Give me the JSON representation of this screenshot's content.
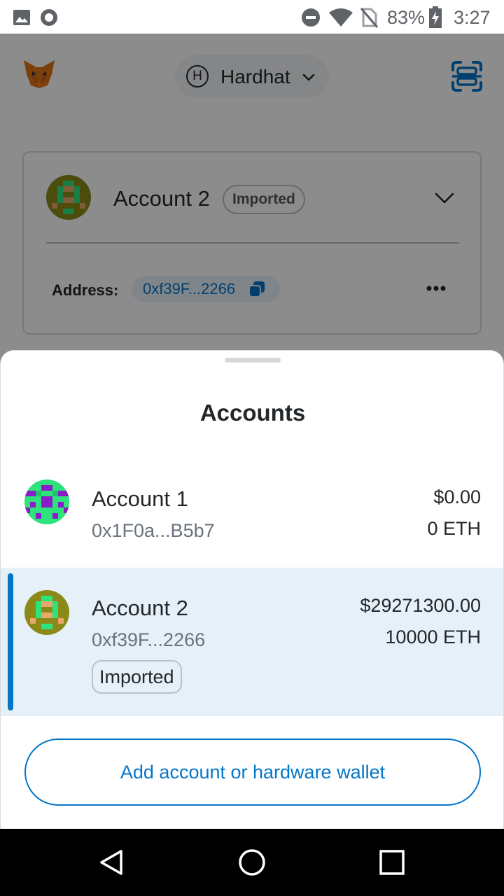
{
  "status_bar": {
    "battery": "83%",
    "time": "3:27",
    "icons": [
      "image-icon",
      "record-icon",
      "do-not-disturb-icon",
      "wifi-icon",
      "no-sim-icon",
      "battery-charging-icon"
    ]
  },
  "header": {
    "logo": "metamask-fox-logo",
    "network": {
      "badge": "H",
      "name": "Hardhat"
    },
    "scan_icon": "qr-scan-icon"
  },
  "account_card": {
    "name": "Account 2",
    "tag": "Imported",
    "address_label": "Address:",
    "address": "0xf39F...2266",
    "more_icon": "more-horizontal-icon"
  },
  "sheet": {
    "title": "Accounts",
    "accounts": [
      {
        "name": "Account 1",
        "address": "0x1F0a...B5b7",
        "fiat": "$0.00",
        "eth": "0 ETH",
        "selected": false
      },
      {
        "name": "Account 2",
        "address": "0xf39F...2266",
        "fiat": "$29271300.00",
        "eth": "10000 ETH",
        "tag": "Imported",
        "selected": true
      }
    ],
    "add_button": "Add account or hardware wallet"
  },
  "nav_bar": {
    "icons": [
      "back-triangle-icon",
      "home-circle-icon",
      "recents-square-icon"
    ]
  },
  "colors": {
    "accent": "#0376c9",
    "selected_row": "#e5f0f9",
    "scrim": "rgba(0,0,0,0.45)"
  }
}
